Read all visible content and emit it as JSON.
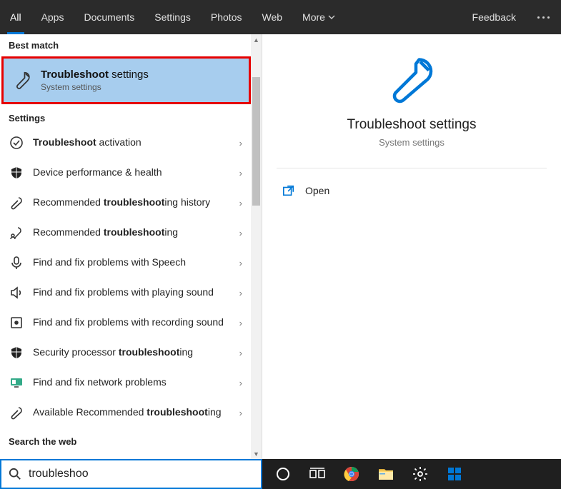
{
  "topbar": {
    "tabs": [
      "All",
      "Apps",
      "Documents",
      "Settings",
      "Photos",
      "Web",
      "More"
    ],
    "feedback": "Feedback"
  },
  "left": {
    "best_match_header": "Best match",
    "best_match": {
      "title_bold": "Troubleshoot",
      "title_rest": " settings",
      "subtitle": "System settings"
    },
    "settings_header": "Settings",
    "results": [
      {
        "pre": "",
        "bold": "Troubleshoot",
        "post": " activation"
      },
      {
        "pre": "Device performance & health",
        "bold": "",
        "post": ""
      },
      {
        "pre": "Recommended ",
        "bold": "troubleshoot",
        "post": "ing history"
      },
      {
        "pre": "Recommended ",
        "bold": "troubleshoot",
        "post": "ing"
      },
      {
        "pre": "Find and fix problems with Speech",
        "bold": "",
        "post": ""
      },
      {
        "pre": "Find and fix problems with playing sound",
        "bold": "",
        "post": ""
      },
      {
        "pre": "Find and fix problems with recording sound",
        "bold": "",
        "post": ""
      },
      {
        "pre": "Security processor ",
        "bold": "troubleshoot",
        "post": "ing"
      },
      {
        "pre": "Find and fix network problems",
        "bold": "",
        "post": ""
      },
      {
        "pre": "Available Recommended ",
        "bold": "troubleshoot",
        "post": "ing"
      }
    ],
    "search_web_header": "Search the web"
  },
  "preview": {
    "title": "Troubleshoot settings",
    "subtitle": "System settings",
    "open": "Open"
  },
  "search": {
    "value": "troubleshoo"
  }
}
